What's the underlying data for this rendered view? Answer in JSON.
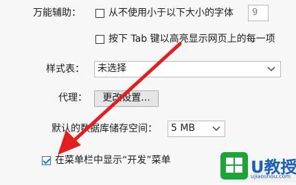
{
  "accessibility": {
    "label": "万能辅助：",
    "min_font_checkbox_label": "从不使用小于以下大小的字体",
    "min_font_size": "9",
    "tab_highlight_checkbox_label": "按下 Tab 键以高亮显示网页上的每一项"
  },
  "stylesheet": {
    "label": "样式表：",
    "selected": "未选择"
  },
  "proxy": {
    "label": "代理：",
    "button_label": "更改设置..."
  },
  "database": {
    "label": "默认的数据库储存空间：",
    "selected": "5 MB"
  },
  "develop_menu": {
    "checkbox_label": "在菜单栏中显示“开发”菜单",
    "checked": true
  },
  "watermark": {
    "text": "U教授",
    "url": "ujiaoshou.com"
  },
  "colors": {
    "arrow": "#e02020",
    "check_accent": "#1f6fd1",
    "logo_green": "#1ea33a",
    "logo_blue": "#1a5fb4"
  },
  "icons": {
    "arrow": "red-annotation-arrow-icon",
    "chevron": "chevron-down-icon",
    "logo": "windows-logo-icon"
  }
}
